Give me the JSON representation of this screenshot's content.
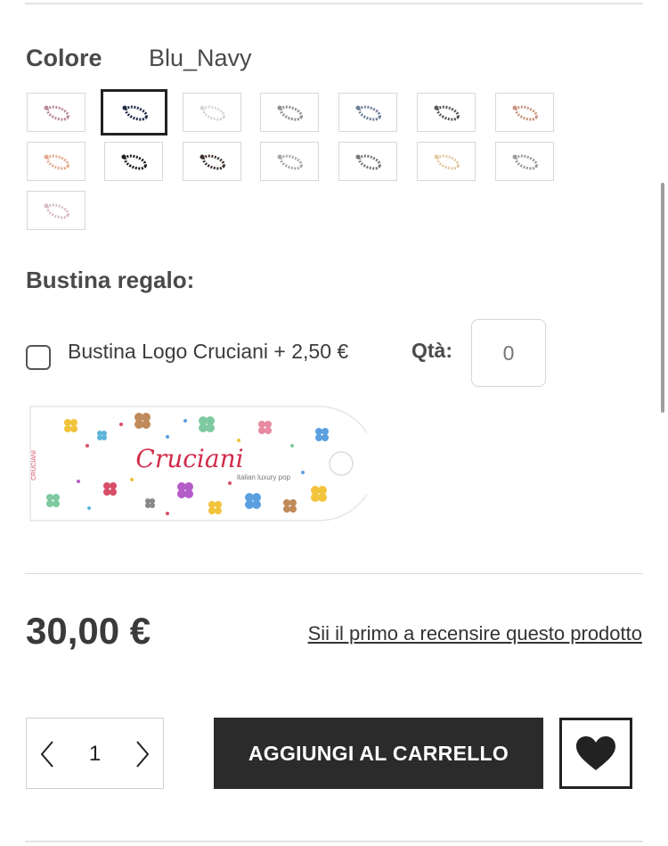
{
  "color": {
    "label": "Colore",
    "selected_value": "Blu_Navy"
  },
  "swatches": [
    {
      "name": "swatch-1",
      "bead": "#b88a95",
      "selected": false
    },
    {
      "name": "swatch-2",
      "bead": "#1f2a44",
      "selected": true
    },
    {
      "name": "swatch-3",
      "bead": "#d6d6d6",
      "selected": false
    },
    {
      "name": "swatch-4",
      "bead": "#8e8e8e",
      "selected": false
    },
    {
      "name": "swatch-5",
      "bead": "#6d7f9a",
      "selected": false
    },
    {
      "name": "swatch-6",
      "bead": "#555555",
      "selected": false
    },
    {
      "name": "swatch-7",
      "bead": "#c9957d",
      "selected": false
    },
    {
      "name": "swatch-8",
      "bead": "#e3a98d",
      "selected": false
    },
    {
      "name": "swatch-9",
      "bead": "#1a1a1a",
      "selected": false
    },
    {
      "name": "swatch-10",
      "bead": "#3a2f2a",
      "selected": false
    },
    {
      "name": "swatch-11",
      "bead": "#a8a8a8",
      "selected": false
    },
    {
      "name": "swatch-12",
      "bead": "#777777",
      "selected": false
    },
    {
      "name": "swatch-13",
      "bead": "#e2c9a3",
      "selected": false
    },
    {
      "name": "swatch-14",
      "bead": "#9b9b9b",
      "selected": false
    },
    {
      "name": "swatch-15",
      "bead": "#d8bcc6",
      "selected": false
    }
  ],
  "gift": {
    "title": "Bustina regalo:",
    "option_label": "Bustina Logo Cruciani + 2,50 €",
    "checked": false,
    "qty_label": "Qtà:",
    "qty_placeholder": "0",
    "brand_logo": "Cruciani",
    "brand_tagline": "italian luxury pop",
    "side_text": "CRUCIANI"
  },
  "price": "30,00 €",
  "review_link": "Sii il primo a recensire questo prodotto",
  "quantity": {
    "value": "1",
    "minus_icon": "chevron-left-icon",
    "plus_icon": "chevron-right-icon"
  },
  "add_to_cart": "AGGIUNGI AL CARRELLO",
  "wishlist_icon": "heart-icon",
  "colors": {
    "button_bg": "#2b2b2b",
    "text": "#3c3c3c",
    "border": "#d9d9d9"
  }
}
